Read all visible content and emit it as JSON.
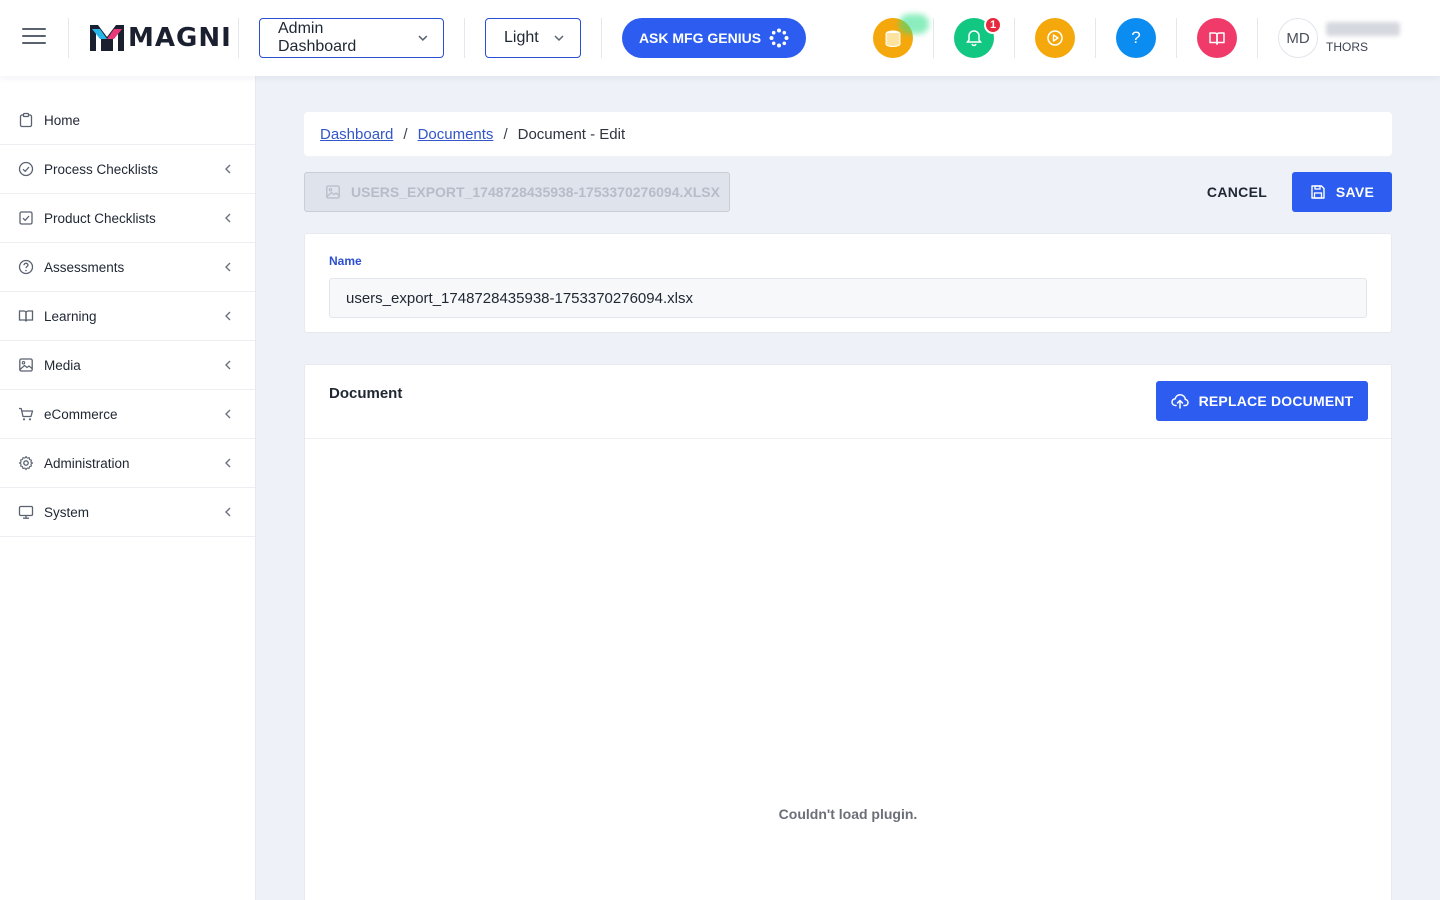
{
  "header": {
    "logo_text": "MAGNI",
    "dashboard_select": "Admin Dashboard",
    "theme_select": "Light",
    "ask_label": "ASK MFG GENIUS",
    "notification_count": "1",
    "help_label": "?",
    "avatar_initials": "MD",
    "user_org": "THORS",
    "colors": {
      "accent": "#2c5cf0",
      "coins": "#f5a80b",
      "bell": "#12c782",
      "play": "#f5a80b",
      "help": "#0a8cf0",
      "book": "#f03b6a"
    }
  },
  "sidebar": {
    "items": [
      {
        "label": "Home",
        "icon": "clipboard-icon",
        "has_arrow": false
      },
      {
        "label": "Process Checklists",
        "icon": "check-circle-icon",
        "has_arrow": true
      },
      {
        "label": "Product Checklists",
        "icon": "check-square-icon",
        "has_arrow": true
      },
      {
        "label": "Assessments",
        "icon": "question-circle-icon",
        "has_arrow": true
      },
      {
        "label": "Learning",
        "icon": "book-icon",
        "has_arrow": true
      },
      {
        "label": "Media",
        "icon": "image-icon",
        "has_arrow": true
      },
      {
        "label": "eCommerce",
        "icon": "cart-icon",
        "has_arrow": true
      },
      {
        "label": "Administration",
        "icon": "gear-icon",
        "has_arrow": true
      },
      {
        "label": "System",
        "icon": "monitor-icon",
        "has_arrow": true
      }
    ]
  },
  "breadcrumb": {
    "link1": "Dashboard",
    "link2": "Documents",
    "current": "Document - Edit",
    "separator": "/"
  },
  "toolbar": {
    "file_name": "USERS_EXPORT_1748728435938-1753370276094.XLSX",
    "cancel_label": "CANCEL",
    "save_label": "SAVE"
  },
  "form": {
    "name_label": "Name",
    "name_value": "users_export_1748728435938-1753370276094.xlsx"
  },
  "document": {
    "title": "Document",
    "replace_label": "REPLACE DOCUMENT",
    "plugin_message": "Couldn't load plugin."
  }
}
